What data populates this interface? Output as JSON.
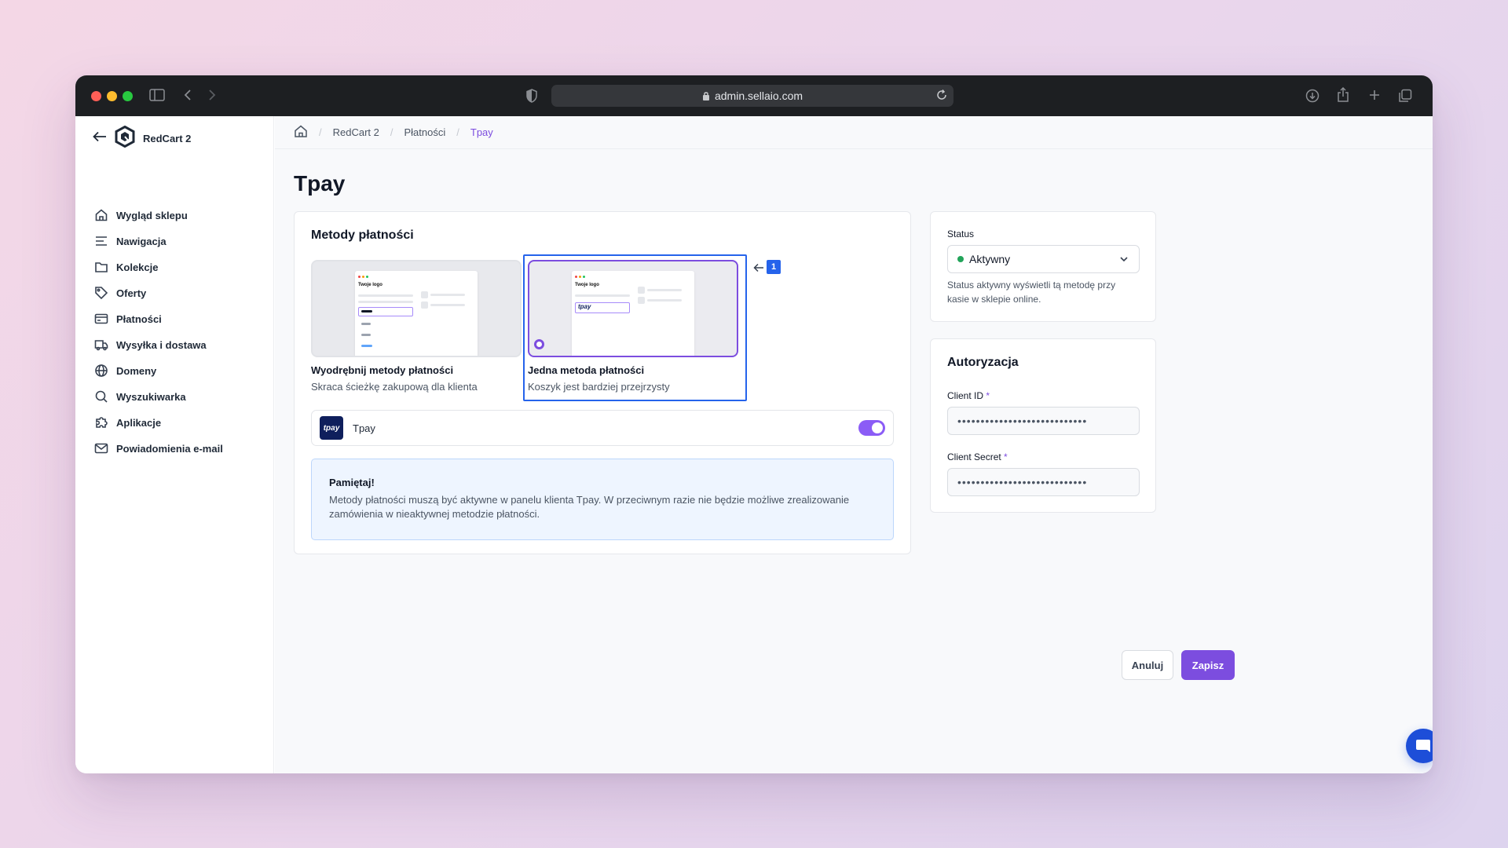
{
  "browser": {
    "url": "admin.sellaio.com"
  },
  "sidebar": {
    "brand": "RedCart 2",
    "items": [
      {
        "label": "Wygląd sklepu",
        "icon": "home-icon"
      },
      {
        "label": "Nawigacja",
        "icon": "menu-icon"
      },
      {
        "label": "Kolekcje",
        "icon": "folder-icon"
      },
      {
        "label": "Oferty",
        "icon": "tag-icon"
      },
      {
        "label": "Płatności",
        "icon": "credit-card-icon"
      },
      {
        "label": "Wysyłka i dostawa",
        "icon": "truck-icon"
      },
      {
        "label": "Domeny",
        "icon": "globe-icon"
      },
      {
        "label": "Wyszukiwarka",
        "icon": "search-icon"
      },
      {
        "label": "Aplikacje",
        "icon": "puzzle-icon"
      },
      {
        "label": "Powiadomienia e-mail",
        "icon": "mail-icon"
      }
    ]
  },
  "breadcrumb": {
    "items": [
      "RedCart 2",
      "Płatności",
      "Tpay"
    ]
  },
  "page": {
    "title": "Tpay"
  },
  "payment_methods": {
    "title": "Metody płatności",
    "options": [
      {
        "label": "Wyodrębnij metody płatności",
        "description": "Skraca ścieżkę zakupową dla klienta",
        "mock_logo": "Twoje logo",
        "selected": false
      },
      {
        "label": "Jedna metoda płatności",
        "description": "Koszyk jest bardziej przejrzysty",
        "mock_logo": "Twoje logo",
        "mock_tpay": "tpay",
        "selected": true
      }
    ],
    "annotation_badge": "1",
    "provider": {
      "logo": "tpay",
      "name": "Tpay",
      "enabled": true
    },
    "notice": {
      "title": "Pamiętaj!",
      "body": "Metody płatności muszą być aktywne w panelu klienta Tpay. W przeciwnym razie nie będzie możliwe zrealizowanie zamówienia w nieaktywnej metodzie płatności."
    }
  },
  "status": {
    "label": "Status",
    "value": "Aktywny",
    "help": "Status aktywny wyświetli tą metodę przy kasie w sklepie online.",
    "color": "#22a45a"
  },
  "auth": {
    "title": "Autoryzacja",
    "client_id_label": "Client ID",
    "client_id_value": "••••••••••••••••••••••••••••",
    "client_secret_label": "Client Secret",
    "client_secret_value": "••••••••••••••••••••••••••••",
    "required_mark": "*"
  },
  "actions": {
    "cancel": "Anuluj",
    "save": "Zapisz"
  },
  "colors": {
    "accent": "#7c4ddf",
    "highlight": "#2563eb",
    "chat": "#1d4ed8"
  }
}
